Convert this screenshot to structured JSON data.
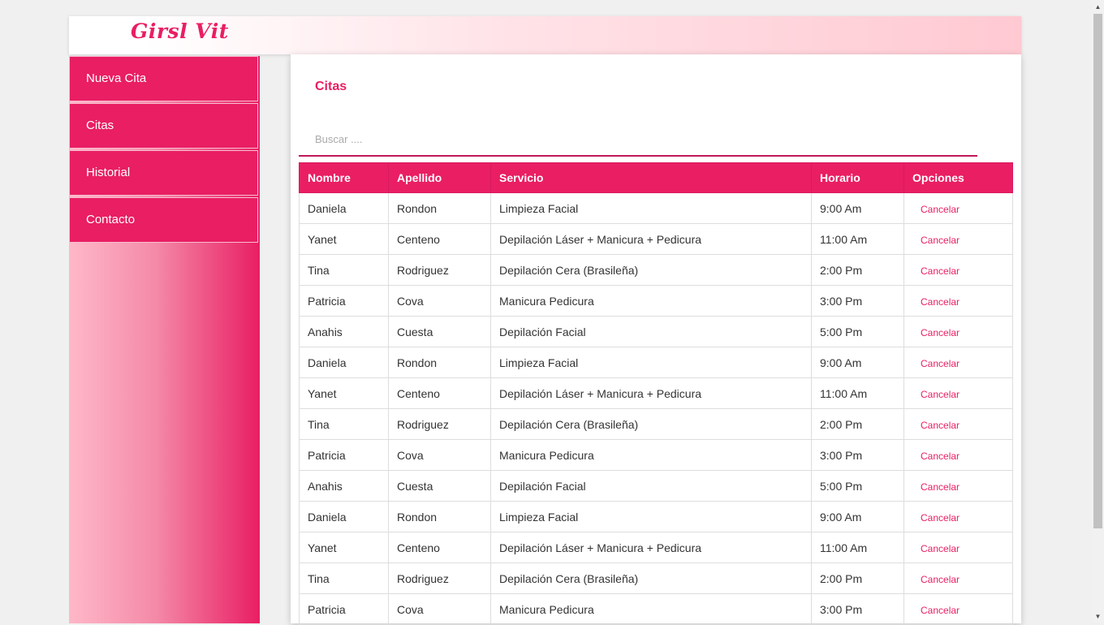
{
  "brand": {
    "logo": "Girsl Vit"
  },
  "sidebar": {
    "items": [
      {
        "label": "Nueva Cita"
      },
      {
        "label": "Citas"
      },
      {
        "label": "Historial"
      },
      {
        "label": "Contacto"
      }
    ]
  },
  "main": {
    "title": "Citas",
    "search_placeholder": "Buscar ....",
    "columns": [
      "Nombre",
      "Apellido",
      "Servicio",
      "Horario",
      "Opciones"
    ],
    "cancel_label": "Cancelar",
    "rows": [
      [
        "Daniela",
        "Rondon",
        "Limpieza Facial",
        "9:00 Am"
      ],
      [
        "Yanet",
        "Centeno",
        "Depilación Láser + Manicura + Pedicura",
        "11:00 Am"
      ],
      [
        "Tina",
        "Rodriguez",
        "Depilación Cera (Brasileña)",
        "2:00 Pm"
      ],
      [
        "Patricia",
        "Cova",
        "Manicura Pedicura",
        "3:00 Pm"
      ],
      [
        "Anahis",
        "Cuesta",
        "Depilación Facial",
        "5:00 Pm"
      ],
      [
        "Daniela",
        "Rondon",
        "Limpieza Facial",
        "9:00 Am"
      ],
      [
        "Yanet",
        "Centeno",
        "Depilación Láser + Manicura + Pedicura",
        "11:00 Am"
      ],
      [
        "Tina",
        "Rodriguez",
        "Depilación Cera (Brasileña)",
        "2:00 Pm"
      ],
      [
        "Patricia",
        "Cova",
        "Manicura Pedicura",
        "3:00 Pm"
      ],
      [
        "Anahis",
        "Cuesta",
        "Depilación Facial",
        "5:00 Pm"
      ],
      [
        "Daniela",
        "Rondon",
        "Limpieza Facial",
        "9:00 Am"
      ],
      [
        "Yanet",
        "Centeno",
        "Depilación Láser + Manicura + Pedicura",
        "11:00 Am"
      ],
      [
        "Tina",
        "Rodriguez",
        "Depilación Cera (Brasileña)",
        "2:00 Pm"
      ],
      [
        "Patricia",
        "Cova",
        "Manicura Pedicura",
        "3:00 Pm"
      ]
    ]
  },
  "colors": {
    "accent": "#e91e63",
    "header_gradient_end": "#ffc9d2"
  }
}
